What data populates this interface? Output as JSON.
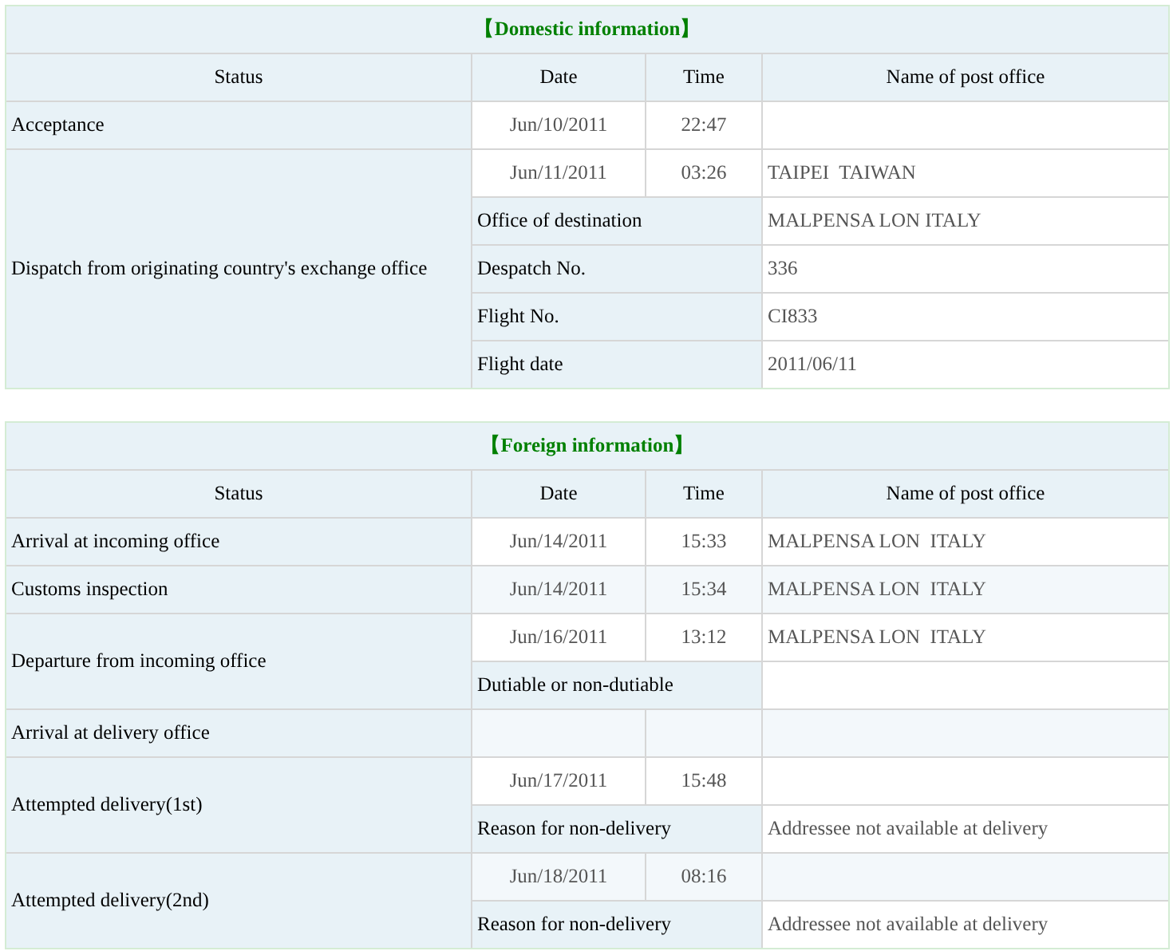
{
  "sections": [
    {
      "title": "【Domestic information】",
      "columns": [
        "Status",
        "Date",
        "Time",
        "Name of post office"
      ],
      "events": [
        {
          "status": "Acceptance",
          "rows": [
            {
              "kind": "timed",
              "date": "Jun/10/2011",
              "time": "22:47"
            }
          ]
        },
        {
          "status": "Dispatch from originating country's exchange office",
          "rows": [
            {
              "kind": "timed",
              "date": "Jun/11/2011",
              "time": "03:26",
              "office": "TAIPEI  TAIWAN"
            },
            {
              "kind": "detail",
              "label": "Office of destination",
              "value": "MALPENSA LON ITALY"
            },
            {
              "kind": "detail",
              "label": "Despatch No.",
              "value": "336"
            },
            {
              "kind": "detail",
              "label": "Flight No.",
              "value": "CI833"
            },
            {
              "kind": "detail",
              "label": "Flight date",
              "value": "2011/06/11"
            }
          ]
        }
      ]
    },
    {
      "title": "【Foreign information】",
      "columns": [
        "Status",
        "Date",
        "Time",
        "Name of post office"
      ],
      "events": [
        {
          "status": "Arrival at incoming office",
          "rows": [
            {
              "kind": "timed",
              "date": "Jun/14/2011",
              "time": "15:33",
              "office": "MALPENSA LON  ITALY"
            }
          ]
        },
        {
          "status": "Customs inspection",
          "rows": [
            {
              "kind": "timed",
              "date": "Jun/14/2011",
              "time": "15:34",
              "office": "MALPENSA LON  ITALY"
            }
          ]
        },
        {
          "status": "Departure from incoming office",
          "rows": [
            {
              "kind": "timed",
              "date": "Jun/16/2011",
              "time": "13:12",
              "office": "MALPENSA LON  ITALY"
            },
            {
              "kind": "detail",
              "label": "Dutiable or non-dutiable"
            }
          ]
        },
        {
          "status": "Arrival at delivery office",
          "rows": [
            {
              "kind": "timed"
            }
          ]
        },
        {
          "status": "Attempted delivery(1st)",
          "rows": [
            {
              "kind": "timed",
              "date": "Jun/17/2011",
              "time": "15:48"
            },
            {
              "kind": "detail",
              "label": "Reason for non-delivery",
              "value": "Addressee not available at delivery"
            }
          ]
        },
        {
          "status": "Attempted delivery(2nd)",
          "rows": [
            {
              "kind": "timed",
              "date": "Jun/18/2011",
              "time": "08:16"
            },
            {
              "kind": "detail",
              "label": "Reason for non-delivery",
              "value": "Addressee not available at delivery"
            }
          ]
        }
      ]
    }
  ]
}
